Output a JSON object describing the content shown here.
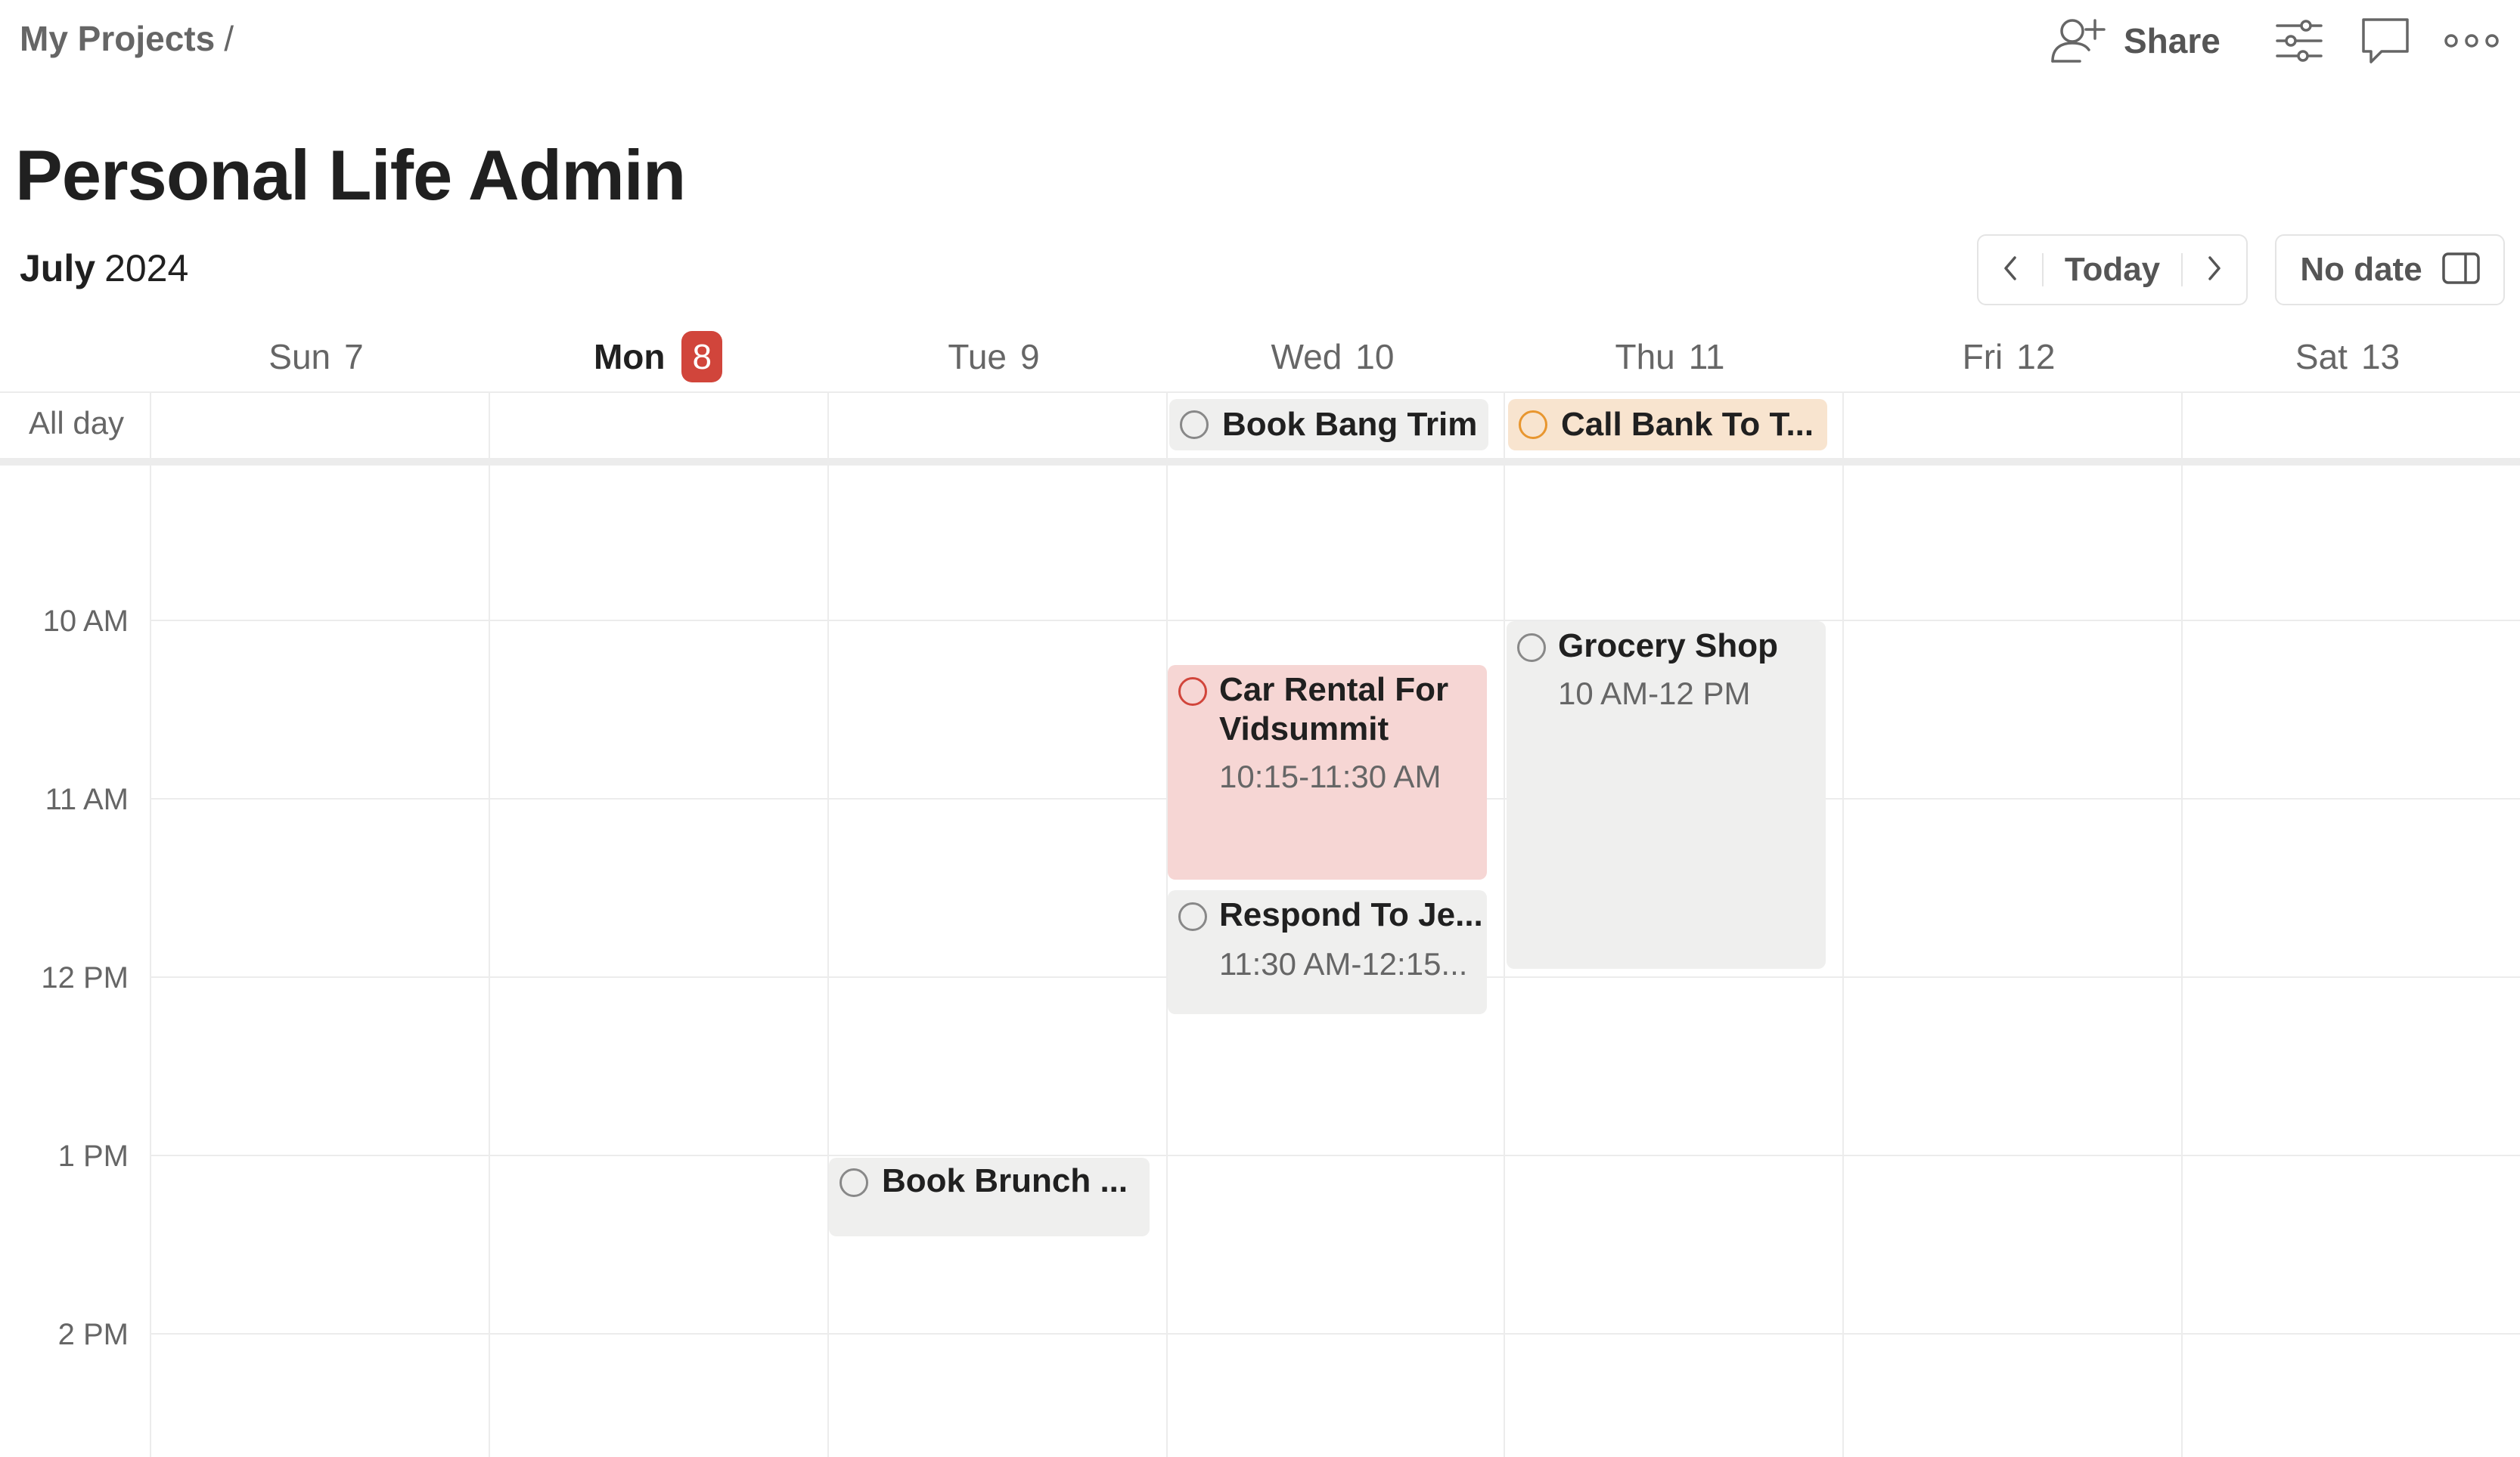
{
  "breadcrumb": {
    "text": "My Projects",
    "separator": "/"
  },
  "toolbar": {
    "share_label": "Share",
    "icons": [
      "add-person-icon",
      "sliders-icon",
      "comment-icon",
      "more-icon"
    ]
  },
  "page": {
    "title": "Personal Life Admin"
  },
  "calendar": {
    "month": "July",
    "year": "2024",
    "today_label": "Today",
    "no_date_label": "No date",
    "all_day_label": "All day",
    "days": [
      {
        "name": "Sun",
        "num": "7"
      },
      {
        "name": "Mon",
        "num": "8"
      },
      {
        "name": "Tue",
        "num": "9"
      },
      {
        "name": "Wed",
        "num": "10"
      },
      {
        "name": "Thu",
        "num": "11"
      },
      {
        "name": "Fri",
        "num": "12"
      },
      {
        "name": "Sat",
        "num": "13"
      }
    ],
    "hours": [
      "10 AM",
      "11 AM",
      "12 PM",
      "1 PM",
      "2 PM"
    ]
  },
  "events": {
    "allday": [
      {
        "title": "Book Bang Trim",
        "day": "Wed"
      },
      {
        "title": "Call Bank To T...",
        "day": "Thu"
      }
    ],
    "timed": [
      {
        "title": "Car Rental For Vidsummit",
        "title_line1": "Car Rental For",
        "title_line2": "Vidsummit",
        "time": "10:15-11:30 AM",
        "day": "Wed"
      },
      {
        "title": "Respond To Je...",
        "time": "11:30 AM-12:15...",
        "day": "Wed"
      },
      {
        "title": "Grocery Shop",
        "time": "10 AM-12 PM",
        "day": "Thu"
      },
      {
        "title": "Book Brunch ...",
        "day": "Tue"
      }
    ]
  },
  "colors": {
    "accent_red": "#d1453b",
    "event_red_bg": "#f6d6d4",
    "event_orange_bg": "#f8e4cf",
    "event_grey_bg": "#efefee"
  }
}
